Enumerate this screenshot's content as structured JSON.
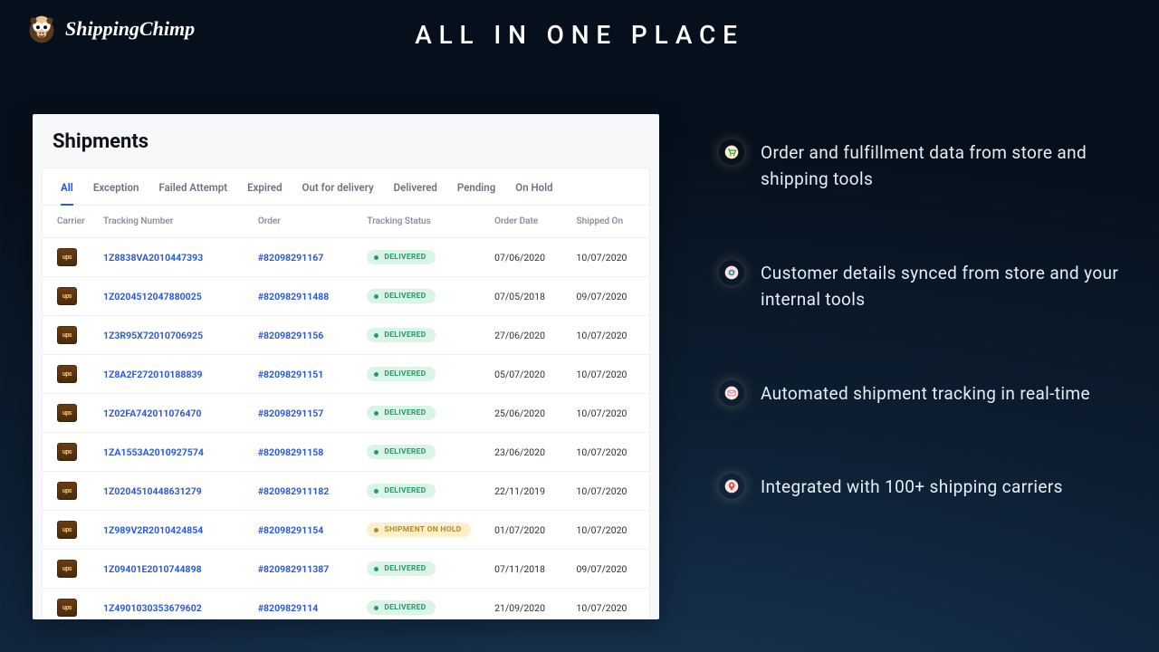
{
  "brand": {
    "name": "ShippingChimp"
  },
  "headline": "ALL IN ONE PLACE",
  "panel": {
    "title": "Shipments"
  },
  "tabs": [
    {
      "label": "All",
      "active": true
    },
    {
      "label": "Exception",
      "active": false
    },
    {
      "label": "Failed Attempt",
      "active": false
    },
    {
      "label": "Expired",
      "active": false
    },
    {
      "label": "Out for delivery",
      "active": false
    },
    {
      "label": "Delivered",
      "active": false
    },
    {
      "label": "Pending",
      "active": false
    },
    {
      "label": "On Hold",
      "active": false
    }
  ],
  "columns": {
    "carrier": "Carrier",
    "tracking": "Tracking Number",
    "order": "Order",
    "status": "Tracking Status",
    "order_date": "Order Date",
    "shipped_on": "Shipped On"
  },
  "status_labels": {
    "delivered": "DELIVERED",
    "on_hold": "SHIPMENT ON HOLD"
  },
  "carrier_badge_text": "ups",
  "rows": [
    {
      "tracking": "1Z8838VA2010447393",
      "order": "#82098291167",
      "status": "delivered",
      "order_date": "07/06/2020",
      "shipped_on": "10/07/2020"
    },
    {
      "tracking": "1Z0204512047880025",
      "order": "#820982911488",
      "status": "delivered",
      "order_date": "07/05/2018",
      "shipped_on": "09/07/2020"
    },
    {
      "tracking": "1Z3R95X72010706925",
      "order": "#82098291156",
      "status": "delivered",
      "order_date": "27/06/2020",
      "shipped_on": "10/07/2020"
    },
    {
      "tracking": "1Z8A2F272010188839",
      "order": "#82098291151",
      "status": "delivered",
      "order_date": "05/07/2020",
      "shipped_on": "10/07/2020"
    },
    {
      "tracking": "1Z02FA742011076470",
      "order": "#82098291157",
      "status": "delivered",
      "order_date": "25/06/2020",
      "shipped_on": "10/07/2020"
    },
    {
      "tracking": "1ZA1553A2010927574",
      "order": "#82098291158",
      "status": "delivered",
      "order_date": "23/06/2020",
      "shipped_on": "10/07/2020"
    },
    {
      "tracking": "1Z0204510448631279",
      "order": "#820982911182",
      "status": "delivered",
      "order_date": "22/11/2019",
      "shipped_on": "10/07/2020"
    },
    {
      "tracking": "1Z989V2R2010424854",
      "order": "#82098291154",
      "status": "on_hold",
      "order_date": "01/07/2020",
      "shipped_on": "10/07/2020"
    },
    {
      "tracking": "1Z09401E2010744898",
      "order": "#820982911387",
      "status": "delivered",
      "order_date": "07/11/2018",
      "shipped_on": "09/07/2020"
    },
    {
      "tracking": "1Z4901030353679602",
      "order": "#8209829114",
      "status": "delivered",
      "order_date": "21/09/2020",
      "shipped_on": "10/07/2020"
    }
  ],
  "features": [
    {
      "icon": "cart",
      "text": "Order and fulfillment data from store and shipping tools"
    },
    {
      "icon": "sync",
      "text": "Customer details synced from store and your internal tools"
    },
    {
      "icon": "mail",
      "text": "Automated shipment tracking in real-time"
    },
    {
      "icon": "pin",
      "text": "Integrated with 100+ shipping carriers"
    }
  ]
}
